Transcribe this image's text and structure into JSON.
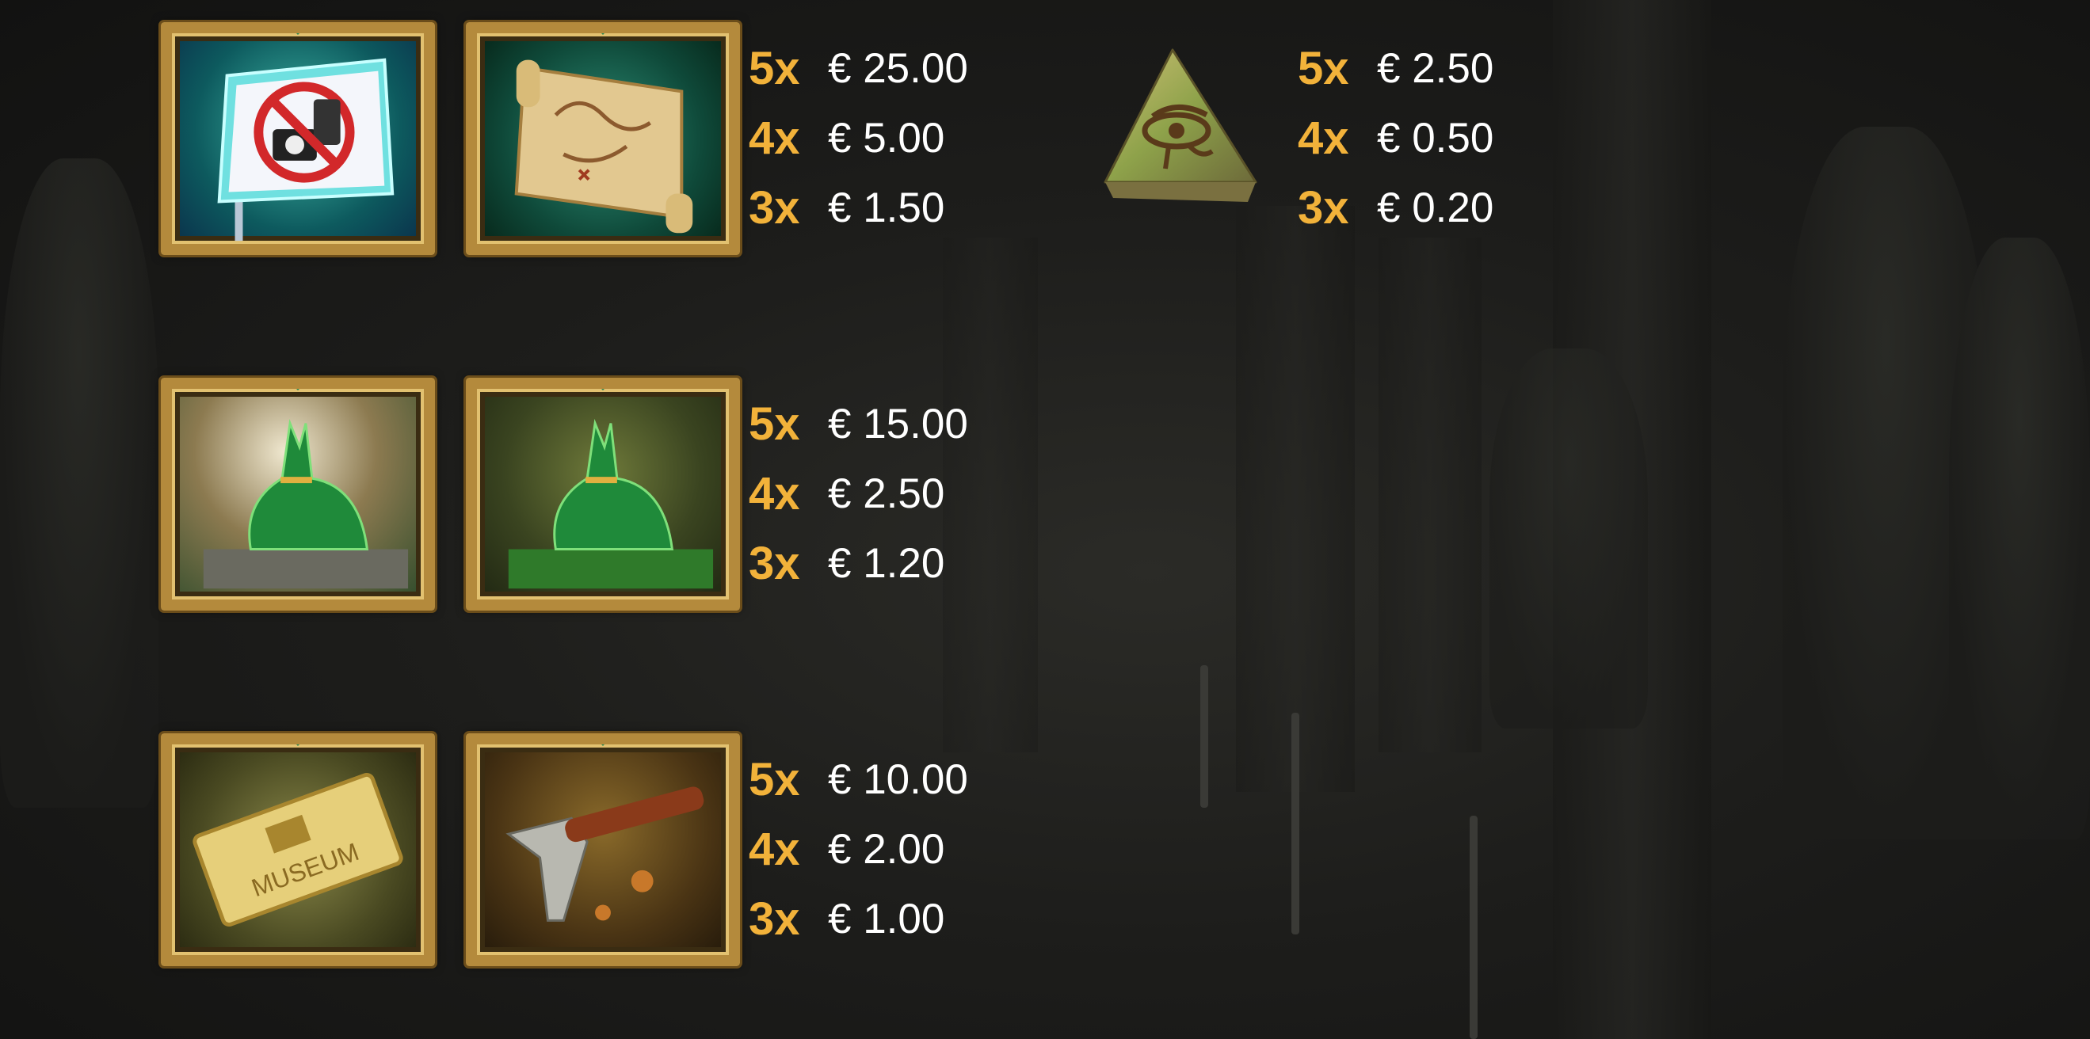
{
  "paytable": [
    {
      "symbols": [
        "no-photo-sign",
        "treasure-map"
      ],
      "pays": [
        {
          "count": "5x",
          "amount": "€ 25.00"
        },
        {
          "count": "4x",
          "amount": "€ 5.00"
        },
        {
          "count": "3x",
          "amount": "€ 1.50"
        }
      ]
    },
    {
      "symbols": [
        "anubis-statue-lit",
        "anubis-statue"
      ],
      "pays": [
        {
          "count": "5x",
          "amount": "€ 15.00"
        },
        {
          "count": "4x",
          "amount": "€ 2.50"
        },
        {
          "count": "3x",
          "amount": "€ 1.20"
        }
      ]
    },
    {
      "symbols": [
        "museum-ticket",
        "rock-hammer"
      ],
      "pays": [
        {
          "count": "5x",
          "amount": "€ 10.00"
        },
        {
          "count": "4x",
          "amount": "€ 2.00"
        },
        {
          "count": "3x",
          "amount": "€ 1.00"
        }
      ],
      "ticket_text": "MUSEUM"
    },
    {
      "symbols": [
        "eye-of-horus-stone"
      ],
      "pays": [
        {
          "count": "5x",
          "amount": "€ 2.50"
        },
        {
          "count": "4x",
          "amount": "€ 0.50"
        },
        {
          "count": "3x",
          "amount": "€ 0.20"
        }
      ]
    }
  ],
  "colors": {
    "multiplier": "#f2b23a",
    "amount": "#ffffff",
    "frame": "#b48a3c"
  }
}
